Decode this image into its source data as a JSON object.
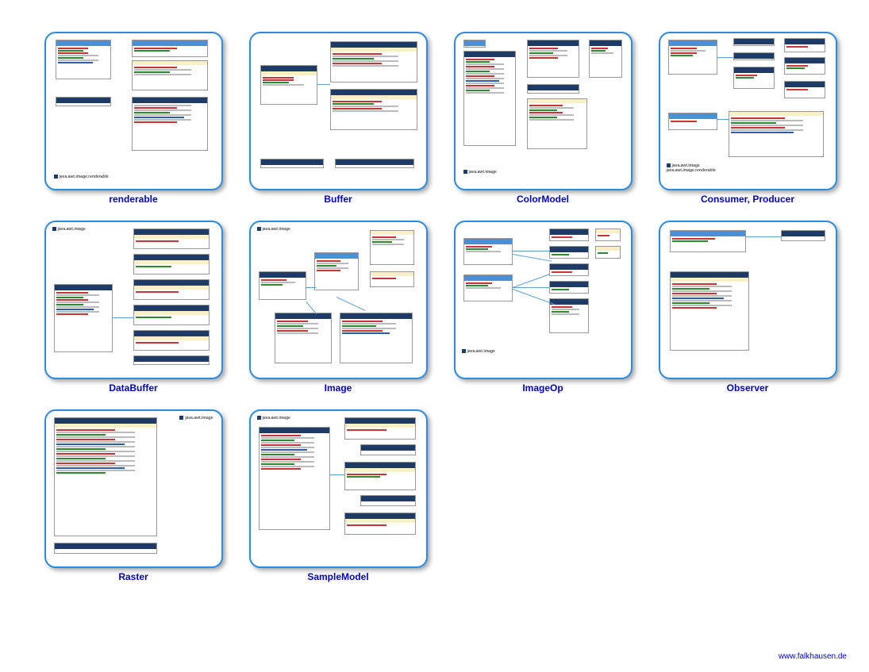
{
  "thumbnails": [
    {
      "label": "renderable",
      "pkg": "java.awt.image.renderable"
    },
    {
      "label": "Buffer",
      "pkg": ""
    },
    {
      "label": "ColorModel",
      "pkg": "java.awt.image"
    },
    {
      "label": "Consumer, Producer",
      "pkg": "java.awt.image\njava.awt.image.renderable"
    },
    {
      "label": "DataBuffer",
      "pkg": "java.awt.image"
    },
    {
      "label": "Image",
      "pkg": "java.awt.image"
    },
    {
      "label": "ImageOp",
      "pkg": "java.awt.image"
    },
    {
      "label": "Observer",
      "pkg": ""
    },
    {
      "label": "Raster",
      "pkg": "java.awt.image"
    },
    {
      "label": "SampleModel",
      "pkg": "java.awt.image"
    }
  ],
  "footer": {
    "link": "www.falkhausen.de"
  }
}
